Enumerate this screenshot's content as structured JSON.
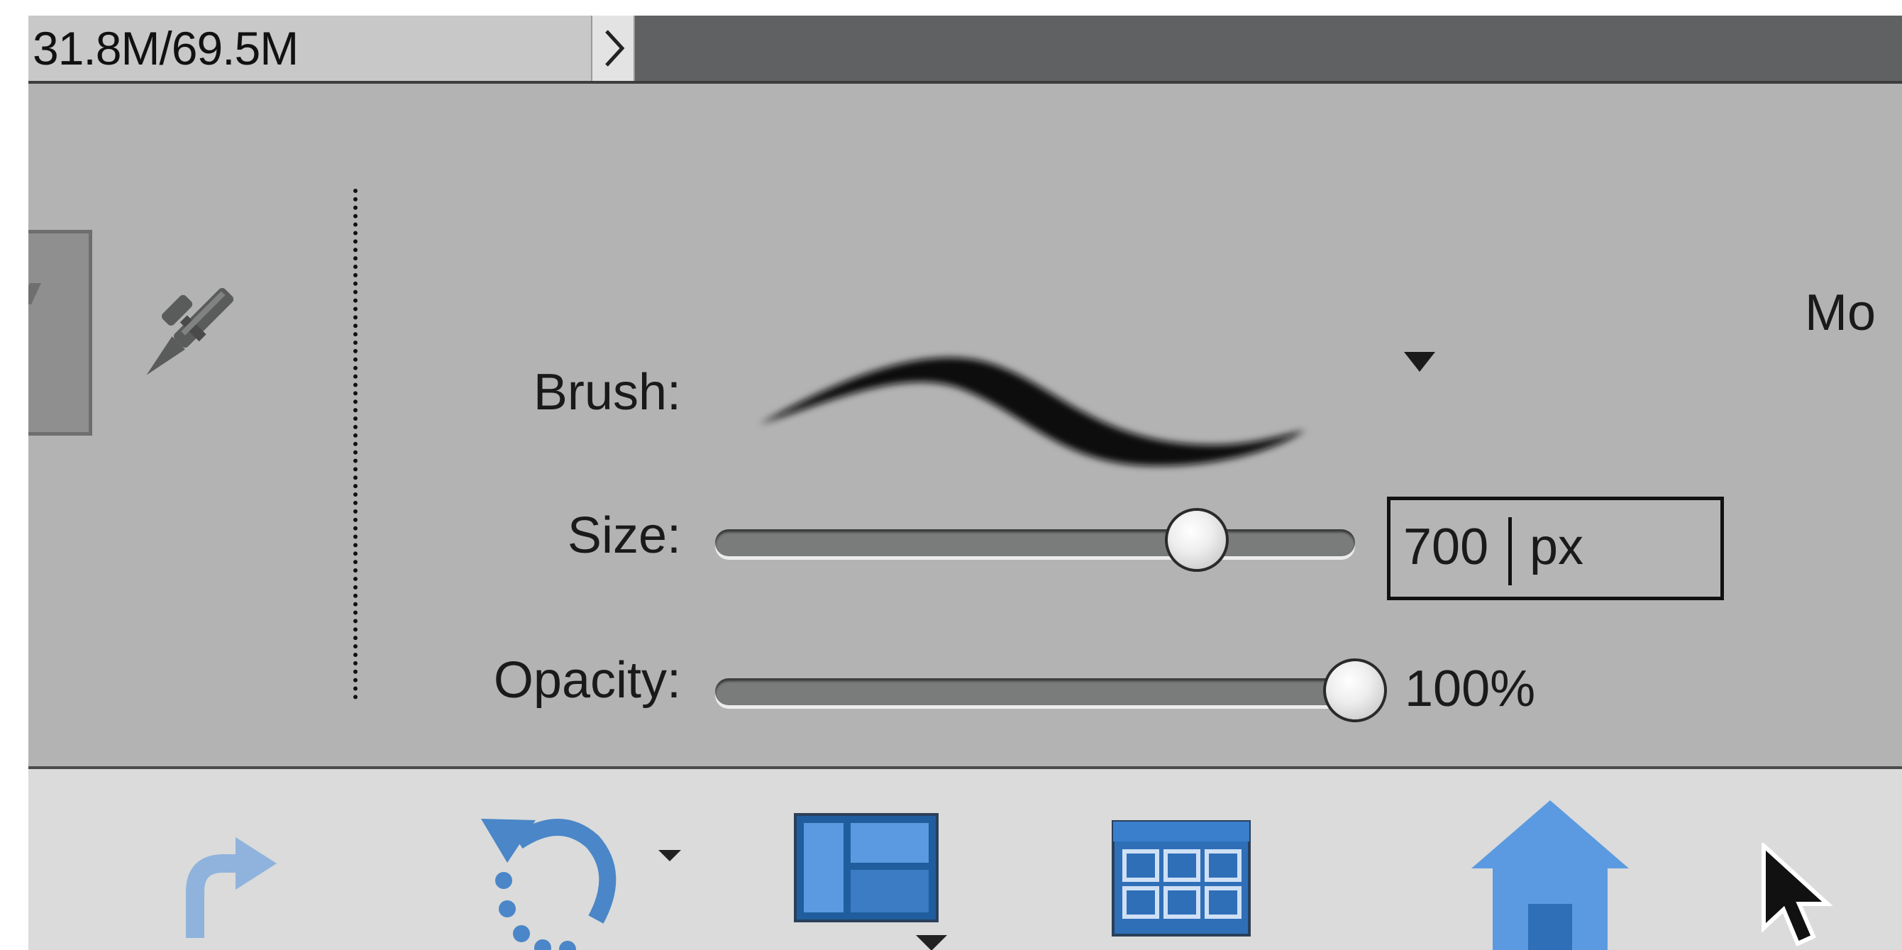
{
  "status_bar": {
    "doc_size": "31.8M/69.5M",
    "expand_icon": "chevron-right-icon"
  },
  "tool_options": {
    "active_tool_icon": "pencil-icon",
    "brush": {
      "label": "Brush:",
      "dropdown_icon": "triangle-down-icon"
    },
    "size": {
      "label": "Size:",
      "value": "700",
      "unit": "px",
      "slider_fraction": 0.74
    },
    "opacity": {
      "label": "Opacity:",
      "value": "100%",
      "slider_fraction": 1.0
    },
    "mode_label_partial": "Mo"
  },
  "taskbar": {
    "icons": [
      "redo-icon",
      "rotate-icon",
      "layout-icon",
      "organizer-grid-icon",
      "home-icon"
    ]
  },
  "colors": {
    "panel_bg": "#b2b3b2",
    "status_bar_bg": "#5f6163",
    "taskbar_bg": "#dadbda",
    "icon_blue": "#4a86c8"
  }
}
